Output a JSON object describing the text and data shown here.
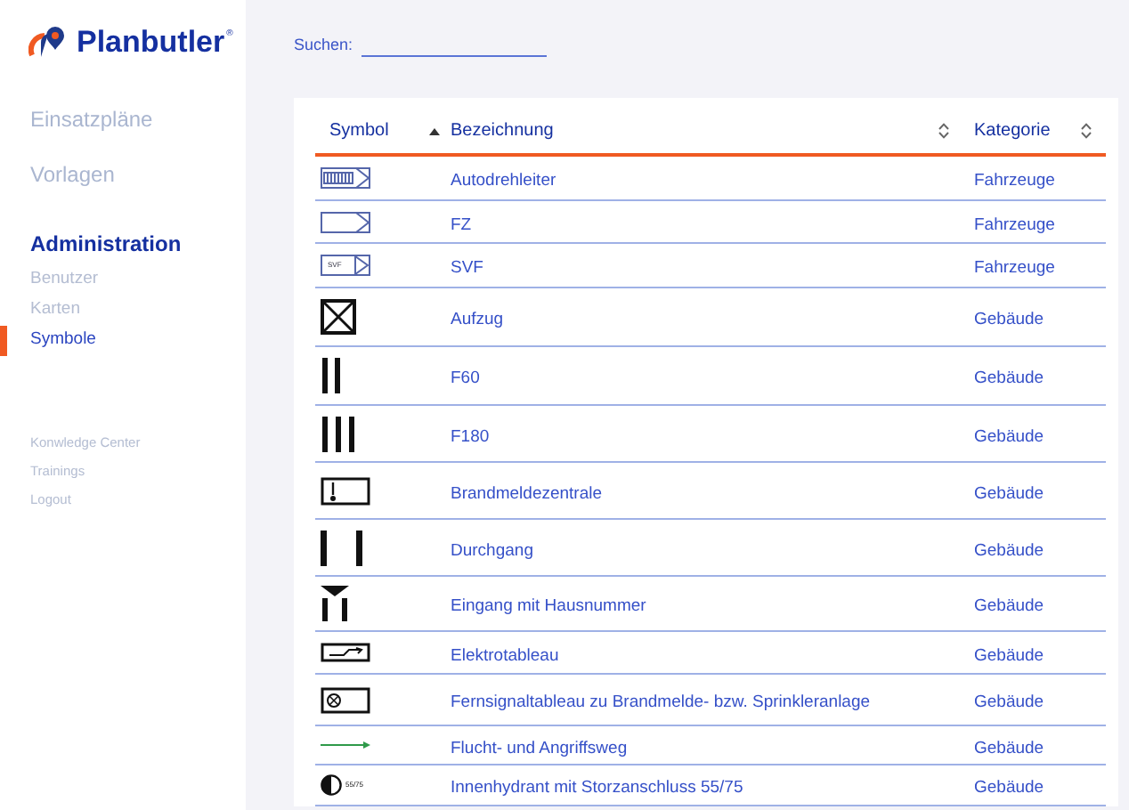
{
  "logo": {
    "name": "Planbutler",
    "mark": "®"
  },
  "sidebar": {
    "items": [
      {
        "label": "Einsatzpläne",
        "kind": "main",
        "selected": false
      },
      {
        "label": "Vorlagen",
        "kind": "main",
        "selected": false
      },
      {
        "label": "Administration",
        "kind": "section",
        "selected": true,
        "children": [
          {
            "label": "Benutzer",
            "selected": false
          },
          {
            "label": "Karten",
            "selected": false
          },
          {
            "label": "Symbole",
            "selected": true
          }
        ]
      }
    ],
    "footer_links": [
      "Konwledge Center",
      "Trainings",
      "Logout"
    ]
  },
  "search": {
    "label": "Suchen:"
  },
  "table": {
    "columns": [
      {
        "label": "Symbol",
        "sorted": true
      },
      {
        "label": "Bezeichnung",
        "sorted": false
      },
      {
        "label": "Kategorie",
        "sorted": false
      }
    ],
    "rows": [
      {
        "kind": "ladder",
        "name": "Autodrehleiter",
        "category": "Fahrzeuge"
      },
      {
        "kind": "vehicle",
        "name": "FZ",
        "category": "Fahrzeuge"
      },
      {
        "kind": "vehicle-text",
        "symbol_text": "SVF",
        "name": "SVF",
        "category": "Fahrzeuge"
      },
      {
        "kind": "elevator",
        "name": "Aufzug",
        "category": "Gebäude"
      },
      {
        "kind": "bars2",
        "name": "F60",
        "category": "Gebäude"
      },
      {
        "kind": "bars3",
        "name": "F180",
        "category": "Gebäude"
      },
      {
        "kind": "fire-panel",
        "name": "Brandmeldezentrale",
        "category": "Gebäude"
      },
      {
        "kind": "passage",
        "name": "Durchgang",
        "category": "Gebäude"
      },
      {
        "kind": "entrance",
        "name": "Eingang mit Hausnummer",
        "category": "Gebäude"
      },
      {
        "kind": "electric",
        "name": "Elektrotableau",
        "category": "Gebäude"
      },
      {
        "kind": "signal",
        "name": "Fernsignaltableau zu Brandmelde- bzw. Sprinkleranlage",
        "category": "Gebäude"
      },
      {
        "kind": "route",
        "name": "Flucht- und Angriffsweg",
        "category": "Gebäude"
      },
      {
        "kind": "hydrant",
        "symbol_text": "55/75",
        "name": "Innenhydrant mit Storzanschluss 55/75",
        "category": "Gebäude"
      }
    ]
  }
}
